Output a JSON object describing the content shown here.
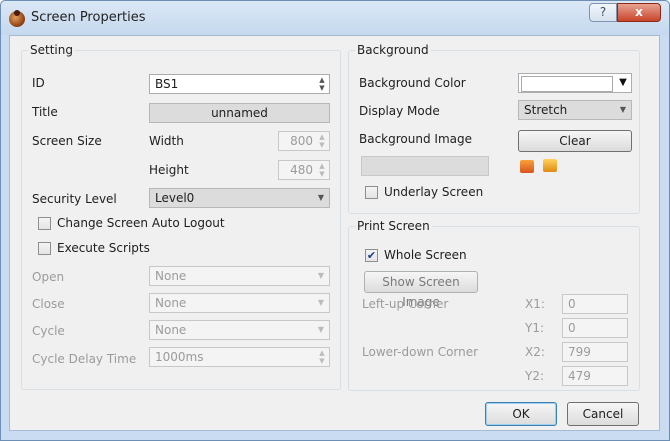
{
  "window": {
    "title": "Screen Properties",
    "help_glyph": "?",
    "close_glyph": "x"
  },
  "setting": {
    "legend": "Setting",
    "id_label": "ID",
    "id_value": "BS1",
    "title_label": "Title",
    "title_value": "unnamed",
    "screen_size_label": "Screen Size",
    "width_label": "Width",
    "width_value": "800",
    "height_label": "Height",
    "height_value": "480",
    "security_label": "Security Level",
    "security_value": "Level0",
    "auto_logout_label": "Change Screen Auto Logout",
    "auto_logout_checked": false,
    "execute_scripts_label": "Execute Scripts",
    "execute_scripts_checked": false,
    "open_label": "Open",
    "open_value": "None",
    "close_label": "Close",
    "close_value": "None",
    "cycle_label": "Cycle",
    "cycle_value": "None",
    "cycle_delay_label": "Cycle Delay Time",
    "cycle_delay_value": "1000ms"
  },
  "background": {
    "legend": "Background",
    "color_label": "Background Color",
    "color_value": "#ffffff",
    "display_mode_label": "Display Mode",
    "display_mode_value": "Stretch",
    "image_label": "Background Image",
    "clear_label": "Clear",
    "image_path": "",
    "underlay_label": "Underlay Screen",
    "underlay_checked": false,
    "import_icon": "image-import-icon",
    "folder_icon": "folder-open-icon"
  },
  "print_screen": {
    "legend": "Print Screen",
    "whole_screen_label": "Whole Screen",
    "whole_screen_checked": true,
    "show_image_label": "Show Screen Image",
    "left_up_label": "Left-up Corner",
    "x1_label": "X1:",
    "x1_value": "0",
    "y1_label": "Y1:",
    "y1_value": "0",
    "lower_down_label": "Lower-down Corner",
    "x2_label": "X2:",
    "x2_value": "799",
    "y2_label": "Y2:",
    "y2_value": "479"
  },
  "footer": {
    "ok_label": "OK",
    "cancel_label": "Cancel"
  },
  "colors": {
    "frame": "#c9dcf1",
    "close_button": "#c7452b",
    "client_bg": "#f0f0f0",
    "check_mark": "#1c3e88"
  },
  "glyphs": {
    "check": "✔",
    "dropdown": "▼",
    "spin_up": "▲",
    "spin_down": "▼"
  }
}
